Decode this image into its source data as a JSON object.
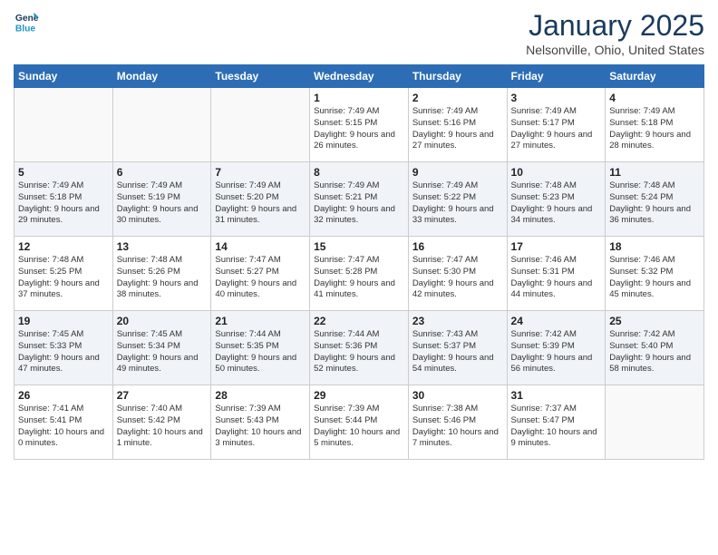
{
  "logo": {
    "line1": "General",
    "line2": "Blue"
  },
  "title": "January 2025",
  "location": "Nelsonville, Ohio, United States",
  "days_of_week": [
    "Sunday",
    "Monday",
    "Tuesday",
    "Wednesday",
    "Thursday",
    "Friday",
    "Saturday"
  ],
  "weeks": [
    [
      {
        "day": "",
        "info": ""
      },
      {
        "day": "",
        "info": ""
      },
      {
        "day": "",
        "info": ""
      },
      {
        "day": "1",
        "info": "Sunrise: 7:49 AM\nSunset: 5:15 PM\nDaylight: 9 hours and 26 minutes."
      },
      {
        "day": "2",
        "info": "Sunrise: 7:49 AM\nSunset: 5:16 PM\nDaylight: 9 hours and 27 minutes."
      },
      {
        "day": "3",
        "info": "Sunrise: 7:49 AM\nSunset: 5:17 PM\nDaylight: 9 hours and 27 minutes."
      },
      {
        "day": "4",
        "info": "Sunrise: 7:49 AM\nSunset: 5:18 PM\nDaylight: 9 hours and 28 minutes."
      }
    ],
    [
      {
        "day": "5",
        "info": "Sunrise: 7:49 AM\nSunset: 5:18 PM\nDaylight: 9 hours and 29 minutes."
      },
      {
        "day": "6",
        "info": "Sunrise: 7:49 AM\nSunset: 5:19 PM\nDaylight: 9 hours and 30 minutes."
      },
      {
        "day": "7",
        "info": "Sunrise: 7:49 AM\nSunset: 5:20 PM\nDaylight: 9 hours and 31 minutes."
      },
      {
        "day": "8",
        "info": "Sunrise: 7:49 AM\nSunset: 5:21 PM\nDaylight: 9 hours and 32 minutes."
      },
      {
        "day": "9",
        "info": "Sunrise: 7:49 AM\nSunset: 5:22 PM\nDaylight: 9 hours and 33 minutes."
      },
      {
        "day": "10",
        "info": "Sunrise: 7:48 AM\nSunset: 5:23 PM\nDaylight: 9 hours and 34 minutes."
      },
      {
        "day": "11",
        "info": "Sunrise: 7:48 AM\nSunset: 5:24 PM\nDaylight: 9 hours and 36 minutes."
      }
    ],
    [
      {
        "day": "12",
        "info": "Sunrise: 7:48 AM\nSunset: 5:25 PM\nDaylight: 9 hours and 37 minutes."
      },
      {
        "day": "13",
        "info": "Sunrise: 7:48 AM\nSunset: 5:26 PM\nDaylight: 9 hours and 38 minutes."
      },
      {
        "day": "14",
        "info": "Sunrise: 7:47 AM\nSunset: 5:27 PM\nDaylight: 9 hours and 40 minutes."
      },
      {
        "day": "15",
        "info": "Sunrise: 7:47 AM\nSunset: 5:28 PM\nDaylight: 9 hours and 41 minutes."
      },
      {
        "day": "16",
        "info": "Sunrise: 7:47 AM\nSunset: 5:30 PM\nDaylight: 9 hours and 42 minutes."
      },
      {
        "day": "17",
        "info": "Sunrise: 7:46 AM\nSunset: 5:31 PM\nDaylight: 9 hours and 44 minutes."
      },
      {
        "day": "18",
        "info": "Sunrise: 7:46 AM\nSunset: 5:32 PM\nDaylight: 9 hours and 45 minutes."
      }
    ],
    [
      {
        "day": "19",
        "info": "Sunrise: 7:45 AM\nSunset: 5:33 PM\nDaylight: 9 hours and 47 minutes."
      },
      {
        "day": "20",
        "info": "Sunrise: 7:45 AM\nSunset: 5:34 PM\nDaylight: 9 hours and 49 minutes."
      },
      {
        "day": "21",
        "info": "Sunrise: 7:44 AM\nSunset: 5:35 PM\nDaylight: 9 hours and 50 minutes."
      },
      {
        "day": "22",
        "info": "Sunrise: 7:44 AM\nSunset: 5:36 PM\nDaylight: 9 hours and 52 minutes."
      },
      {
        "day": "23",
        "info": "Sunrise: 7:43 AM\nSunset: 5:37 PM\nDaylight: 9 hours and 54 minutes."
      },
      {
        "day": "24",
        "info": "Sunrise: 7:42 AM\nSunset: 5:39 PM\nDaylight: 9 hours and 56 minutes."
      },
      {
        "day": "25",
        "info": "Sunrise: 7:42 AM\nSunset: 5:40 PM\nDaylight: 9 hours and 58 minutes."
      }
    ],
    [
      {
        "day": "26",
        "info": "Sunrise: 7:41 AM\nSunset: 5:41 PM\nDaylight: 10 hours and 0 minutes."
      },
      {
        "day": "27",
        "info": "Sunrise: 7:40 AM\nSunset: 5:42 PM\nDaylight: 10 hours and 1 minute."
      },
      {
        "day": "28",
        "info": "Sunrise: 7:39 AM\nSunset: 5:43 PM\nDaylight: 10 hours and 3 minutes."
      },
      {
        "day": "29",
        "info": "Sunrise: 7:39 AM\nSunset: 5:44 PM\nDaylight: 10 hours and 5 minutes."
      },
      {
        "day": "30",
        "info": "Sunrise: 7:38 AM\nSunset: 5:46 PM\nDaylight: 10 hours and 7 minutes."
      },
      {
        "day": "31",
        "info": "Sunrise: 7:37 AM\nSunset: 5:47 PM\nDaylight: 10 hours and 9 minutes."
      },
      {
        "day": "",
        "info": ""
      }
    ]
  ]
}
